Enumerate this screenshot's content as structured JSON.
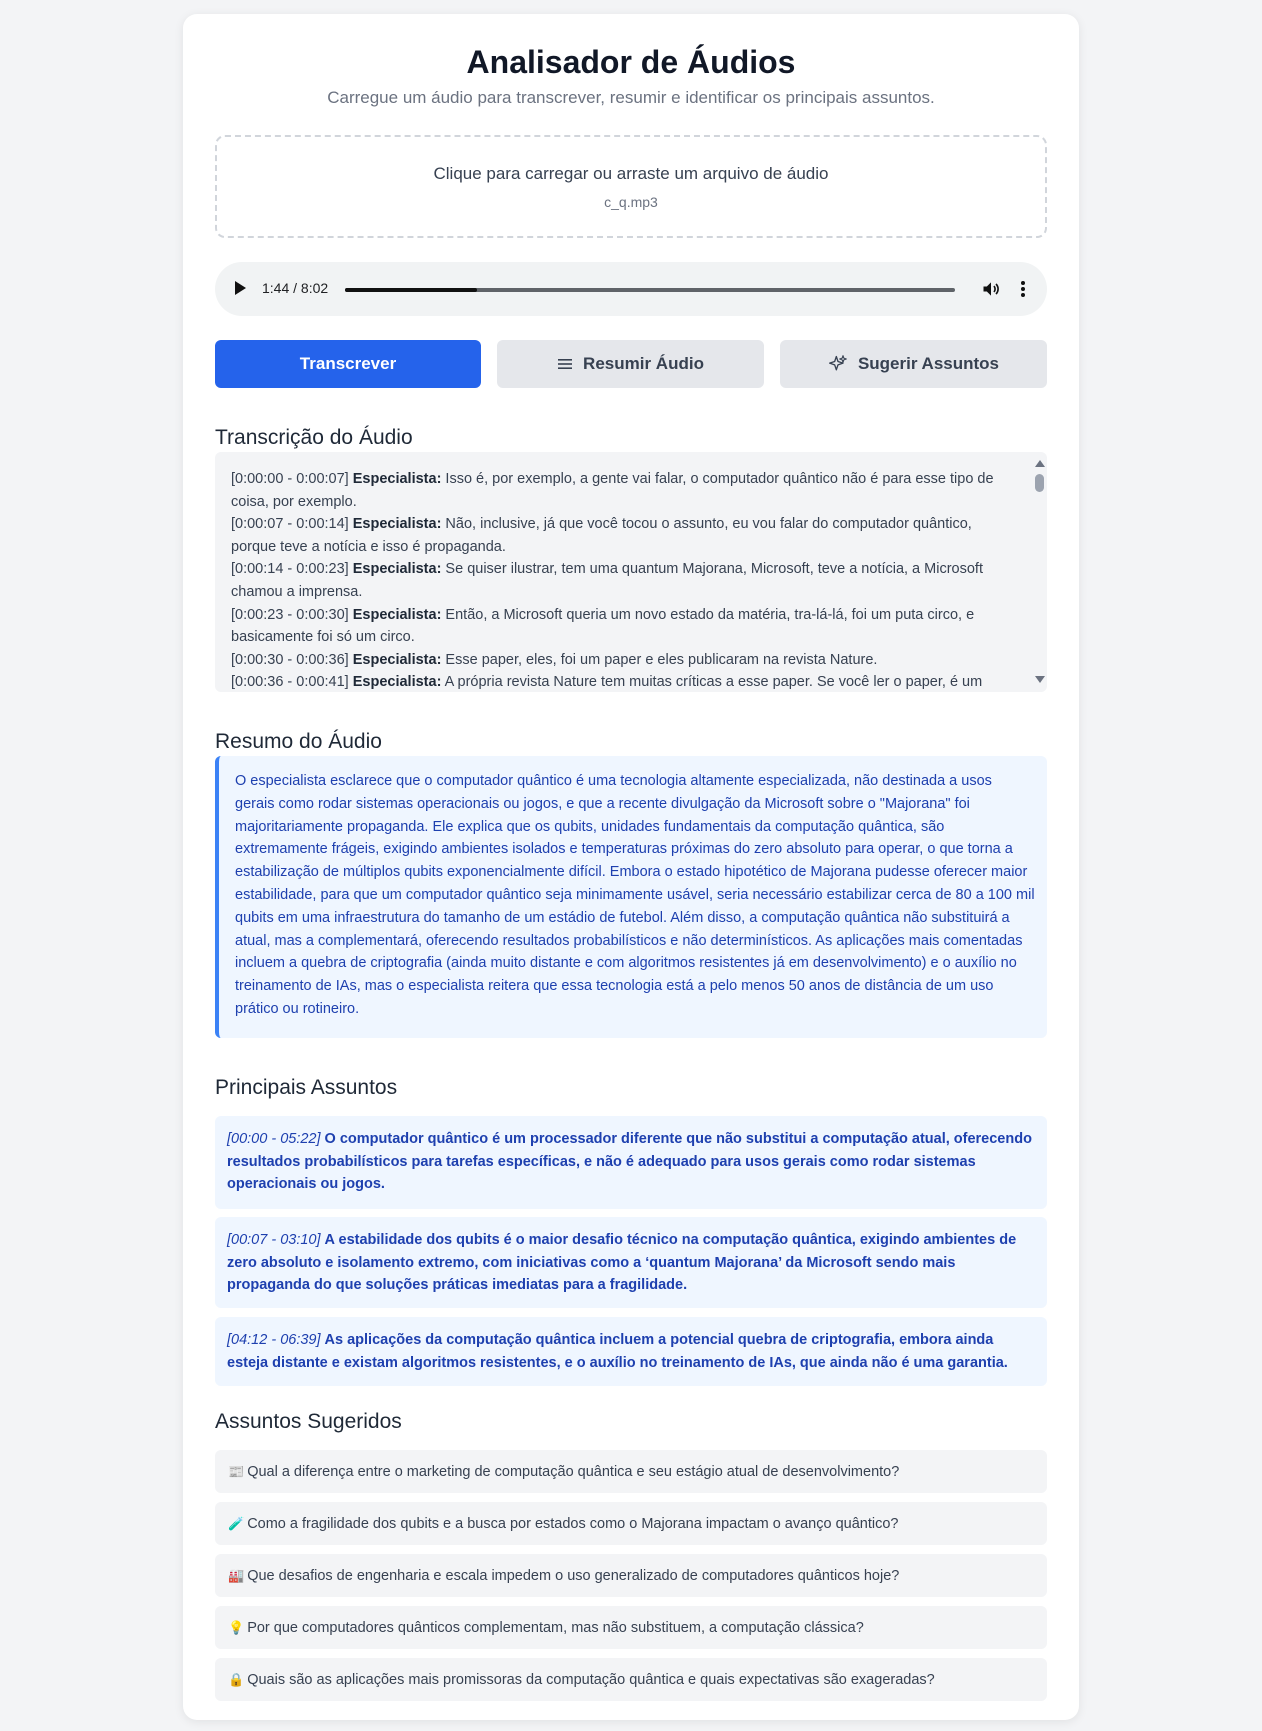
{
  "header": {
    "title": "Analisador de Áudios",
    "subtitle": "Carregue um áudio para transcrever, resumir e identificar os principais assuntos."
  },
  "upload": {
    "prompt": "Clique para carregar ou arraste um arquivo de áudio",
    "filename": "c_q.mp3"
  },
  "player": {
    "time": "1:44 / 8:02",
    "progress": 0.216
  },
  "buttons": {
    "transcribe": "Transcrever",
    "summarize": "Resumir Áudio",
    "suggest": "Sugerir Assuntos"
  },
  "transcript": {
    "title": "Transcrição do Áudio",
    "lines": [
      {
        "time": "[0:00:00 - 0:00:07]",
        "speaker": "Especialista:",
        "text": "Isso é, por exemplo, a gente vai falar, o computador quântico não é para esse tipo de coisa, por exemplo."
      },
      {
        "time": "[0:00:07 - 0:00:14]",
        "speaker": "Especialista:",
        "text": "Não, inclusive, já que você tocou o assunto, eu vou falar do computador quântico, porque teve a notícia e isso é propaganda."
      },
      {
        "time": "[0:00:14 - 0:00:23]",
        "speaker": "Especialista:",
        "text": "Se quiser ilustrar, tem uma quantum Majorana, Microsoft, teve a notícia, a Microsoft chamou a imprensa."
      },
      {
        "time": "[0:00:23 - 0:00:30]",
        "speaker": "Especialista:",
        "text": "Então, a Microsoft queria um novo estado da matéria, tra-lá-lá, foi um puta circo, e basicamente foi só um circo."
      },
      {
        "time": "[0:00:30 - 0:00:36]",
        "speaker": "Especialista:",
        "text": "Esse paper, eles, foi um paper e eles publicaram na revista Nature."
      },
      {
        "time": "[0:00:36 - 0:00:41]",
        "speaker": "Especialista:",
        "text": "A própria revista Nature tem muitas críticas a esse paper. Se você ler o paper, é um"
      }
    ]
  },
  "summary": {
    "title": "Resumo do Áudio",
    "text": "O especialista esclarece que o computador quântico é uma tecnologia altamente especializada, não destinada a usos gerais como rodar sistemas operacionais ou jogos, e que a recente divulgação da Microsoft sobre o \"Majorana\" foi majoritariamente propaganda. Ele explica que os qubits, unidades fundamentais da computação quântica, são extremamente frágeis, exigindo ambientes isolados e temperaturas próximas do zero absoluto para operar, o que torna a estabilização de múltiplos qubits exponencialmente difícil. Embora o estado hipotético de Majorana pudesse oferecer maior estabilidade, para que um computador quântico seja minimamente usável, seria necessário estabilizar cerca de 80 a 100 mil qubits em uma infraestrutura do tamanho de um estádio de futebol. Além disso, a computação quântica não substituirá a atual, mas a complementará, oferecendo resultados probabilísticos e não determinísticos. As aplicações mais comentadas incluem a quebra de criptografia (ainda muito distante e com algoritmos resistentes já em desenvolvimento) e o auxílio no treinamento de IAs, mas o especialista reitera que essa tecnologia está a pelo menos 50 anos de distância de um uso prático ou rotineiro."
  },
  "topics": {
    "title": "Principais Assuntos",
    "items": [
      {
        "time": "[00:00 - 05:22]",
        "text": "O computador quântico é um processador diferente que não substitui a computação atual, oferecendo resultados probabilísticos para tarefas específicas, e não é adequado para usos gerais como rodar sistemas operacionais ou jogos."
      },
      {
        "time": "[00:07 - 03:10]",
        "text": "A estabilidade dos qubits é o maior desafio técnico na computação quântica, exigindo ambientes de zero absoluto e isolamento extremo, com iniciativas como a ‘quantum Majorana’ da Microsoft sendo mais propaganda do que soluções práticas imediatas para a fragilidade."
      },
      {
        "time": "[04:12 - 06:39]",
        "text": "As aplicações da computação quântica incluem a potencial quebra de criptografia, embora ainda esteja distante e existam algoritmos resistentes, e o auxílio no treinamento de IAs, que ainda não é uma garantia."
      }
    ]
  },
  "suggestions": {
    "title": "Assuntos Sugeridos",
    "items": [
      {
        "icon": "📰",
        "text": "Qual a diferença entre o marketing de computação quântica e seu estágio atual de desenvolvimento?"
      },
      {
        "icon": "🧪",
        "text": "Como a fragilidade dos qubits e a busca por estados como o Majorana impactam o avanço quântico?"
      },
      {
        "icon": "🏭",
        "text": "Que desafios de engenharia e escala impedem o uso generalizado de computadores quânticos hoje?"
      },
      {
        "icon": "💡",
        "text": "Por que computadores quânticos complementam, mas não substituem, a computação clássica?"
      },
      {
        "icon": "🔒",
        "text": "Quais são as aplicações mais promissoras da computação quântica e quais expectativas são exageradas?"
      }
    ]
  },
  "colors": {
    "primary": "#2563eb",
    "summary_bg": "#eff6ff",
    "summary_text": "#1e40af",
    "summary_border": "#3b82f6"
  }
}
